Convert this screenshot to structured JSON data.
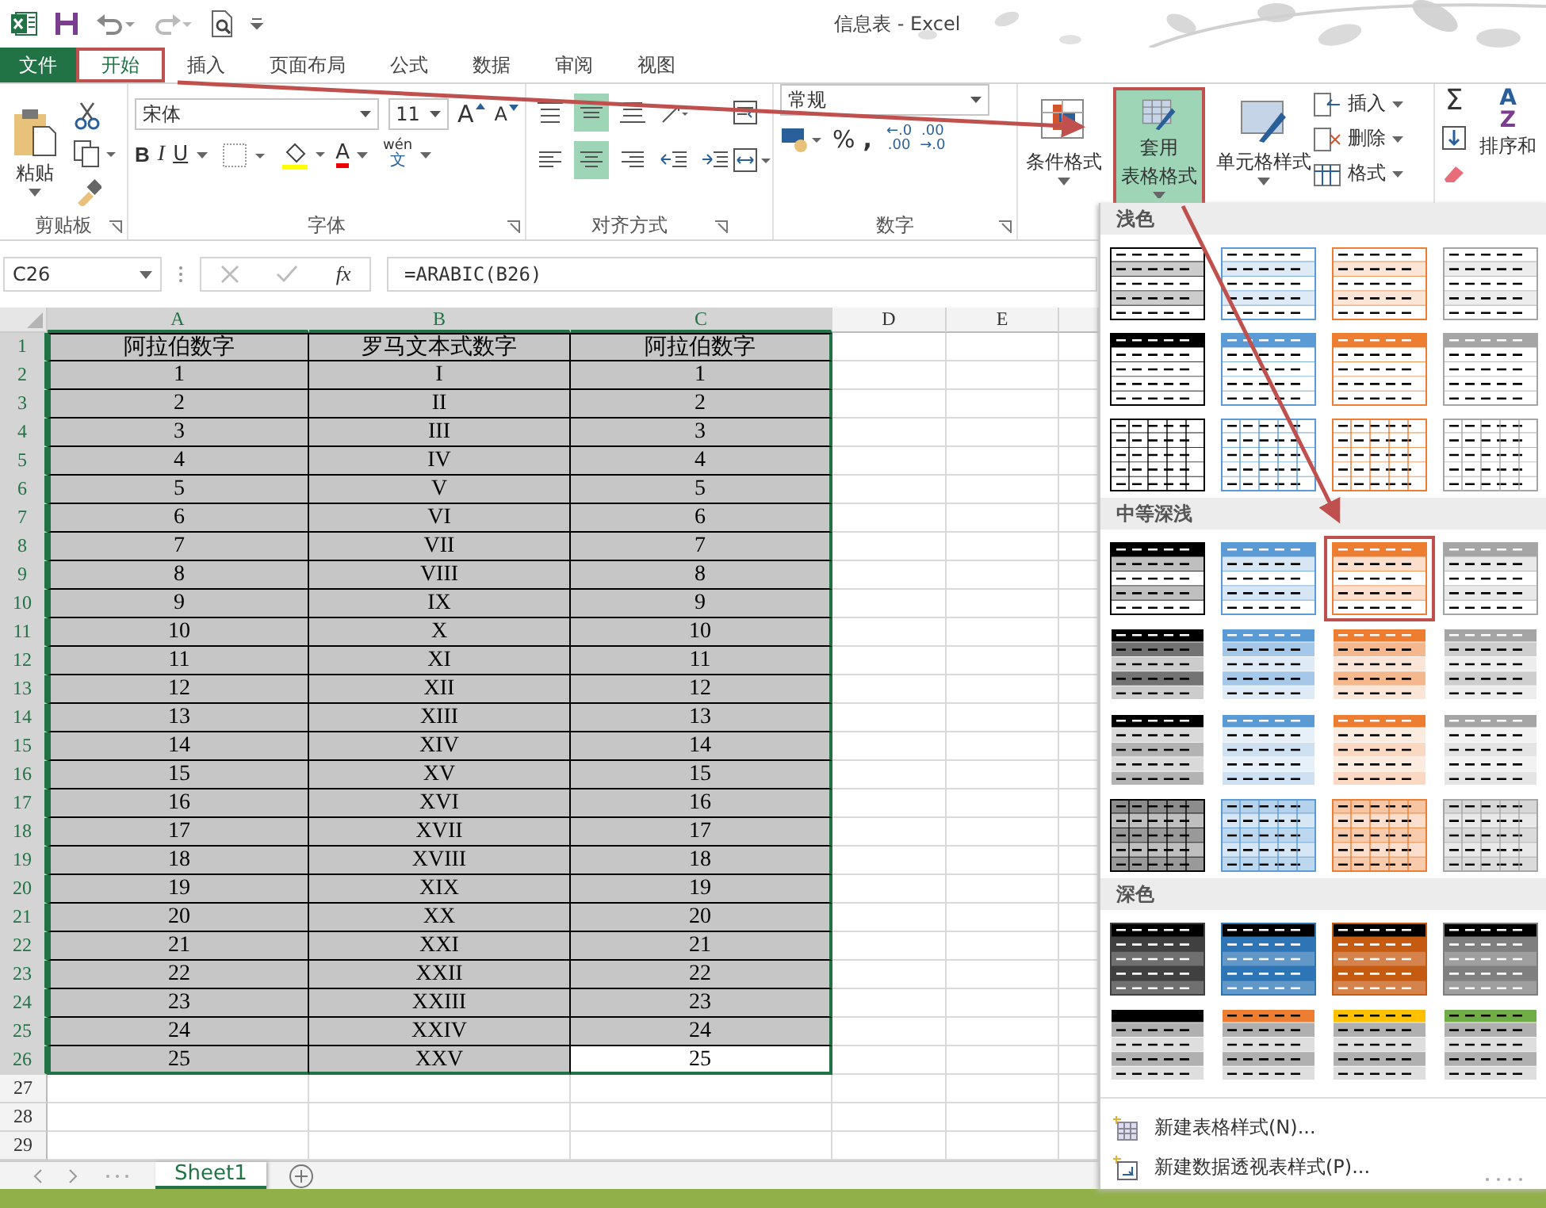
{
  "window": {
    "title": "信息表 - Excel"
  },
  "tabs": [
    {
      "label": "文件",
      "kind": "file",
      "selected": false,
      "annotated": false
    },
    {
      "label": "开始",
      "kind": "tab",
      "selected": true,
      "annotated": true
    },
    {
      "label": "插入",
      "kind": "tab",
      "selected": false,
      "annotated": false
    },
    {
      "label": "页面布局",
      "kind": "tab",
      "selected": false,
      "annotated": false
    },
    {
      "label": "公式",
      "kind": "tab",
      "selected": false,
      "annotated": false
    },
    {
      "label": "数据",
      "kind": "tab",
      "selected": false,
      "annotated": false
    },
    {
      "label": "审阅",
      "kind": "tab",
      "selected": false,
      "annotated": false
    },
    {
      "label": "视图",
      "kind": "tab",
      "selected": false,
      "annotated": false
    }
  ],
  "ribbon": {
    "clipboard": {
      "paste": "粘贴",
      "label": "剪贴板"
    },
    "font": {
      "name": "宋体",
      "size": "11",
      "grow": "A",
      "shrink": "A",
      "bold": "B",
      "italic": "I",
      "underline": "U",
      "font_color": "A",
      "phonetic_top": "wén",
      "phonetic_bottom": "文",
      "label": "字体"
    },
    "alignment": {
      "label": "对齐方式",
      "buttons": [
        {
          "kind": "top",
          "on": false
        },
        {
          "kind": "middle",
          "on": true
        },
        {
          "kind": "bottom",
          "on": false
        },
        {
          "kind": "orient",
          "on": false
        },
        {
          "kind": "left",
          "on": false
        },
        {
          "kind": "center",
          "on": true
        },
        {
          "kind": "right",
          "on": false
        },
        {
          "kind": "outdent",
          "on": false
        },
        {
          "kind": "indent",
          "on": false
        }
      ]
    },
    "number": {
      "format": "常规",
      "percent": "%",
      "comma": ",",
      "inc_decimal": [
        "←.0",
        ".00"
      ],
      "dec_decimal": [
        ".00",
        "→.0"
      ],
      "label": "数字"
    },
    "styles": [
      {
        "kind": "conditional",
        "lines": [
          "条件格式"
        ],
        "on": false,
        "annotated": false
      },
      {
        "kind": "table",
        "lines": [
          "套用",
          "表格格式"
        ],
        "on": true,
        "annotated": true
      },
      {
        "kind": "cell",
        "lines": [
          "单元格样式"
        ],
        "on": false,
        "annotated": false
      }
    ],
    "cells": [
      {
        "kind": "insert",
        "label": "插入"
      },
      {
        "kind": "delete",
        "label": "删除"
      },
      {
        "kind": "format",
        "label": "格式"
      }
    ],
    "editing": {
      "sum": "Σ",
      "sort_letters": [
        "A",
        "Z"
      ],
      "sort": "排序和"
    }
  },
  "formula_bar": {
    "name_box": "C26",
    "function_label": "fx",
    "formula": "=ARABIC(B26)"
  },
  "sheet": {
    "columns": [
      {
        "label": "A",
        "selected": true
      },
      {
        "label": "B",
        "selected": true
      },
      {
        "label": "C",
        "selected": true
      },
      {
        "label": "D",
        "selected": false
      },
      {
        "label": "E",
        "selected": false
      }
    ],
    "rows": [
      {
        "label": "1",
        "selected": true,
        "cells": [
          {
            "text": "阿拉伯数字",
            "active": false
          },
          {
            "text": "罗马文本式数字",
            "active": false
          },
          {
            "text": "阿拉伯数字",
            "active": false
          }
        ]
      },
      {
        "label": "2",
        "selected": true,
        "cells": [
          {
            "text": "1",
            "active": false
          },
          {
            "text": "I",
            "active": false
          },
          {
            "text": "1",
            "active": false
          }
        ]
      },
      {
        "label": "3",
        "selected": true,
        "cells": [
          {
            "text": "2",
            "active": false
          },
          {
            "text": "II",
            "active": false
          },
          {
            "text": "2",
            "active": false
          }
        ]
      },
      {
        "label": "4",
        "selected": true,
        "cells": [
          {
            "text": "3",
            "active": false
          },
          {
            "text": "III",
            "active": false
          },
          {
            "text": "3",
            "active": false
          }
        ]
      },
      {
        "label": "5",
        "selected": true,
        "cells": [
          {
            "text": "4",
            "active": false
          },
          {
            "text": "IV",
            "active": false
          },
          {
            "text": "4",
            "active": false
          }
        ]
      },
      {
        "label": "6",
        "selected": true,
        "cells": [
          {
            "text": "5",
            "active": false
          },
          {
            "text": "V",
            "active": false
          },
          {
            "text": "5",
            "active": false
          }
        ]
      },
      {
        "label": "7",
        "selected": true,
        "cells": [
          {
            "text": "6",
            "active": false
          },
          {
            "text": "VI",
            "active": false
          },
          {
            "text": "6",
            "active": false
          }
        ]
      },
      {
        "label": "8",
        "selected": true,
        "cells": [
          {
            "text": "7",
            "active": false
          },
          {
            "text": "VII",
            "active": false
          },
          {
            "text": "7",
            "active": false
          }
        ]
      },
      {
        "label": "9",
        "selected": true,
        "cells": [
          {
            "text": "8",
            "active": false
          },
          {
            "text": "VIII",
            "active": false
          },
          {
            "text": "8",
            "active": false
          }
        ]
      },
      {
        "label": "10",
        "selected": true,
        "cells": [
          {
            "text": "9",
            "active": false
          },
          {
            "text": "IX",
            "active": false
          },
          {
            "text": "9",
            "active": false
          }
        ]
      },
      {
        "label": "11",
        "selected": true,
        "cells": [
          {
            "text": "10",
            "active": false
          },
          {
            "text": "X",
            "active": false
          },
          {
            "text": "10",
            "active": false
          }
        ]
      },
      {
        "label": "12",
        "selected": true,
        "cells": [
          {
            "text": "11",
            "active": false
          },
          {
            "text": "XI",
            "active": false
          },
          {
            "text": "11",
            "active": false
          }
        ]
      },
      {
        "label": "13",
        "selected": true,
        "cells": [
          {
            "text": "12",
            "active": false
          },
          {
            "text": "XII",
            "active": false
          },
          {
            "text": "12",
            "active": false
          }
        ]
      },
      {
        "label": "14",
        "selected": true,
        "cells": [
          {
            "text": "13",
            "active": false
          },
          {
            "text": "XIII",
            "active": false
          },
          {
            "text": "13",
            "active": false
          }
        ]
      },
      {
        "label": "15",
        "selected": true,
        "cells": [
          {
            "text": "14",
            "active": false
          },
          {
            "text": "XIV",
            "active": false
          },
          {
            "text": "14",
            "active": false
          }
        ]
      },
      {
        "label": "16",
        "selected": true,
        "cells": [
          {
            "text": "15",
            "active": false
          },
          {
            "text": "XV",
            "active": false
          },
          {
            "text": "15",
            "active": false
          }
        ]
      },
      {
        "label": "17",
        "selected": true,
        "cells": [
          {
            "text": "16",
            "active": false
          },
          {
            "text": "XVI",
            "active": false
          },
          {
            "text": "16",
            "active": false
          }
        ]
      },
      {
        "label": "18",
        "selected": true,
        "cells": [
          {
            "text": "17",
            "active": false
          },
          {
            "text": "XVII",
            "active": false
          },
          {
            "text": "17",
            "active": false
          }
        ]
      },
      {
        "label": "19",
        "selected": true,
        "cells": [
          {
            "text": "18",
            "active": false
          },
          {
            "text": "XVIII",
            "active": false
          },
          {
            "text": "18",
            "active": false
          }
        ]
      },
      {
        "label": "20",
        "selected": true,
        "cells": [
          {
            "text": "19",
            "active": false
          },
          {
            "text": "XIX",
            "active": false
          },
          {
            "text": "19",
            "active": false
          }
        ]
      },
      {
        "label": "21",
        "selected": true,
        "cells": [
          {
            "text": "20",
            "active": false
          },
          {
            "text": "XX",
            "active": false
          },
          {
            "text": "20",
            "active": false
          }
        ]
      },
      {
        "label": "22",
        "selected": true,
        "cells": [
          {
            "text": "21",
            "active": false
          },
          {
            "text": "XXI",
            "active": false
          },
          {
            "text": "21",
            "active": false
          }
        ]
      },
      {
        "label": "23",
        "selected": true,
        "cells": [
          {
            "text": "22",
            "active": false
          },
          {
            "text": "XXII",
            "active": false
          },
          {
            "text": "22",
            "active": false
          }
        ]
      },
      {
        "label": "24",
        "selected": true,
        "cells": [
          {
            "text": "23",
            "active": false
          },
          {
            "text": "XXIII",
            "active": false
          },
          {
            "text": "23",
            "active": false
          }
        ]
      },
      {
        "label": "25",
        "selected": true,
        "cells": [
          {
            "text": "24",
            "active": false
          },
          {
            "text": "XXIV",
            "active": false
          },
          {
            "text": "24",
            "active": false
          }
        ]
      },
      {
        "label": "26",
        "selected": true,
        "cells": [
          {
            "text": "25",
            "active": false
          },
          {
            "text": "XXV",
            "active": false
          },
          {
            "text": "25",
            "active": true
          }
        ]
      },
      {
        "label": "27",
        "selected": false
      },
      {
        "label": "28",
        "selected": false
      },
      {
        "label": "29",
        "selected": false
      }
    ],
    "tabs": [
      {
        "label": "Sheet1",
        "selected": true
      }
    ]
  },
  "gallery": {
    "sections": [
      {
        "title": "浅色",
        "rows": [
          {
            "kind": "light-banded",
            "swatches": [
              {
                "color": "#000000",
                "annotated": false
              },
              {
                "color": "#5b9bd5",
                "annotated": false
              },
              {
                "color": "#ed7d31",
                "annotated": false
              },
              {
                "color": "#a5a5a5",
                "annotated": false
              }
            ]
          },
          {
            "kind": "light-header",
            "swatches": [
              {
                "color": "#000000",
                "annotated": false
              },
              {
                "color": "#5b9bd5",
                "annotated": false
              },
              {
                "color": "#ed7d31",
                "annotated": false
              },
              {
                "color": "#a5a5a5",
                "annotated": false
              }
            ]
          },
          {
            "kind": "light-grid",
            "swatches": [
              {
                "color": "#000000",
                "annotated": false
              },
              {
                "color": "#5b9bd5",
                "annotated": false
              },
              {
                "color": "#ed7d31",
                "annotated": false
              },
              {
                "color": "#a5a5a5",
                "annotated": false
              }
            ]
          }
        ]
      },
      {
        "title": "中等深浅",
        "rows": [
          {
            "kind": "medium-banded",
            "swatches": [
              {
                "color": "#000000",
                "annotated": false
              },
              {
                "color": "#5b9bd5",
                "annotated": false
              },
              {
                "color": "#ed7d31",
                "annotated": true
              },
              {
                "color": "#a5a5a5",
                "annotated": false
              }
            ]
          },
          {
            "kind": "medium-striped",
            "swatches": [
              {
                "color": "#000000",
                "annotated": false
              },
              {
                "color": "#5b9bd5",
                "annotated": false
              },
              {
                "color": "#ed7d31",
                "annotated": false
              },
              {
                "color": "#a5a5a5",
                "annotated": false
              }
            ]
          },
          {
            "kind": "medium-header",
            "swatches": [
              {
                "color": "#000000",
                "annotated": false
              },
              {
                "color": "#5b9bd5",
                "annotated": false
              },
              {
                "color": "#ed7d31",
                "annotated": false
              },
              {
                "color": "#a5a5a5",
                "annotated": false
              }
            ]
          },
          {
            "kind": "medium-tint",
            "swatches": [
              {
                "color": "#000000",
                "annotated": false
              },
              {
                "color": "#5b9bd5",
                "annotated": false
              },
              {
                "color": "#ed7d31",
                "annotated": false
              },
              {
                "color": "#a5a5a5",
                "annotated": false
              }
            ]
          }
        ]
      },
      {
        "title": "深色",
        "rows": [
          {
            "kind": "dark",
            "swatches": [
              {
                "color": "#404040",
                "annotated": false
              },
              {
                "color": "#2e75b6",
                "annotated": false
              },
              {
                "color": "#c55a11",
                "annotated": false
              },
              {
                "color": "#7f7f7f",
                "annotated": false
              }
            ]
          },
          {
            "kind": "dark-header",
            "swatches": [
              {
                "color": "#000000",
                "annotated": false
              },
              {
                "color": "#ed7d31",
                "annotated": false
              },
              {
                "color": "#ffc000",
                "annotated": false
              },
              {
                "color": "#70ad47",
                "annotated": false
              }
            ]
          }
        ]
      }
    ],
    "actions": [
      {
        "kind": "table",
        "label": "新建表格样式(N)..."
      },
      {
        "kind": "pivot",
        "label": "新建数据透视表样式(P)..."
      }
    ]
  }
}
